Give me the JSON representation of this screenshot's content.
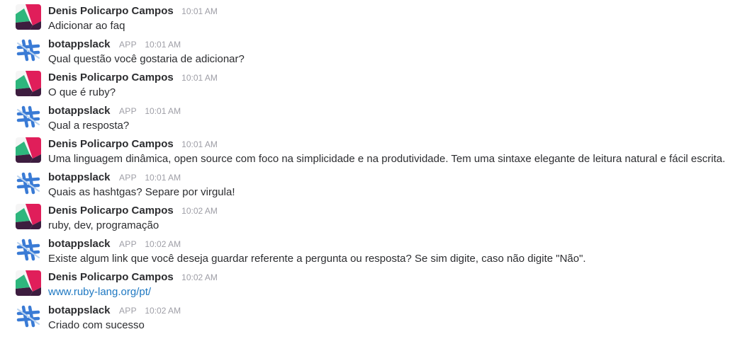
{
  "users": {
    "denis": {
      "name": "Denis Policarpo Campos",
      "avatar_icon": "user-avatar-icon"
    },
    "bot": {
      "name": "botappslack",
      "badge": "APP",
      "avatar_icon": "bot-avatar-icon"
    }
  },
  "colors": {
    "avatar_white": "#f5f5f5",
    "avatar_red": "#e01e5a",
    "avatar_green": "#2eb67d",
    "avatar_dark": "#3d1d3f",
    "bot_blue": "#3a7bd5",
    "link": "#1e78c2",
    "meta": "#9e9ea6"
  },
  "messages": [
    {
      "sender": "Denis Policarpo Campos",
      "time": "10:01 AM",
      "text": "Adicionar ao faq"
    },
    {
      "sender": "botappslack",
      "badge": "APP",
      "time": "10:01 AM",
      "text": "Qual questão você gostaria de adicionar?"
    },
    {
      "sender": "Denis Policarpo Campos",
      "time": "10:01 AM",
      "text": "O que é ruby?"
    },
    {
      "sender": "botappslack",
      "badge": "APP",
      "time": "10:01 AM",
      "text": "Qual a resposta?"
    },
    {
      "sender": "Denis Policarpo Campos",
      "time": "10:01 AM",
      "text": "Uma linguagem dinâmica, open source com foco na simplicidade e na produtividade. Tem uma sintaxe elegante de leitura natural e fácil escrita."
    },
    {
      "sender": "botappslack",
      "badge": "APP",
      "time": "10:01 AM",
      "text": "Quais as hashtgas? Separe por virgula!"
    },
    {
      "sender": "Denis Policarpo Campos",
      "time": "10:02 AM",
      "text": "ruby, dev, programação"
    },
    {
      "sender": "botappslack",
      "badge": "APP",
      "time": "10:02 AM",
      "text": "Existe algum link que você deseja guardar referente a pergunta ou resposta? Se sim digite, caso não digite \"Não\"."
    },
    {
      "sender": "Denis Policarpo Campos",
      "time": "10:02 AM",
      "text": "www.ruby-lang.org/pt/"
    },
    {
      "sender": "botappslack",
      "badge": "APP",
      "time": "10:02 AM",
      "text": "Criado com sucesso"
    }
  ]
}
